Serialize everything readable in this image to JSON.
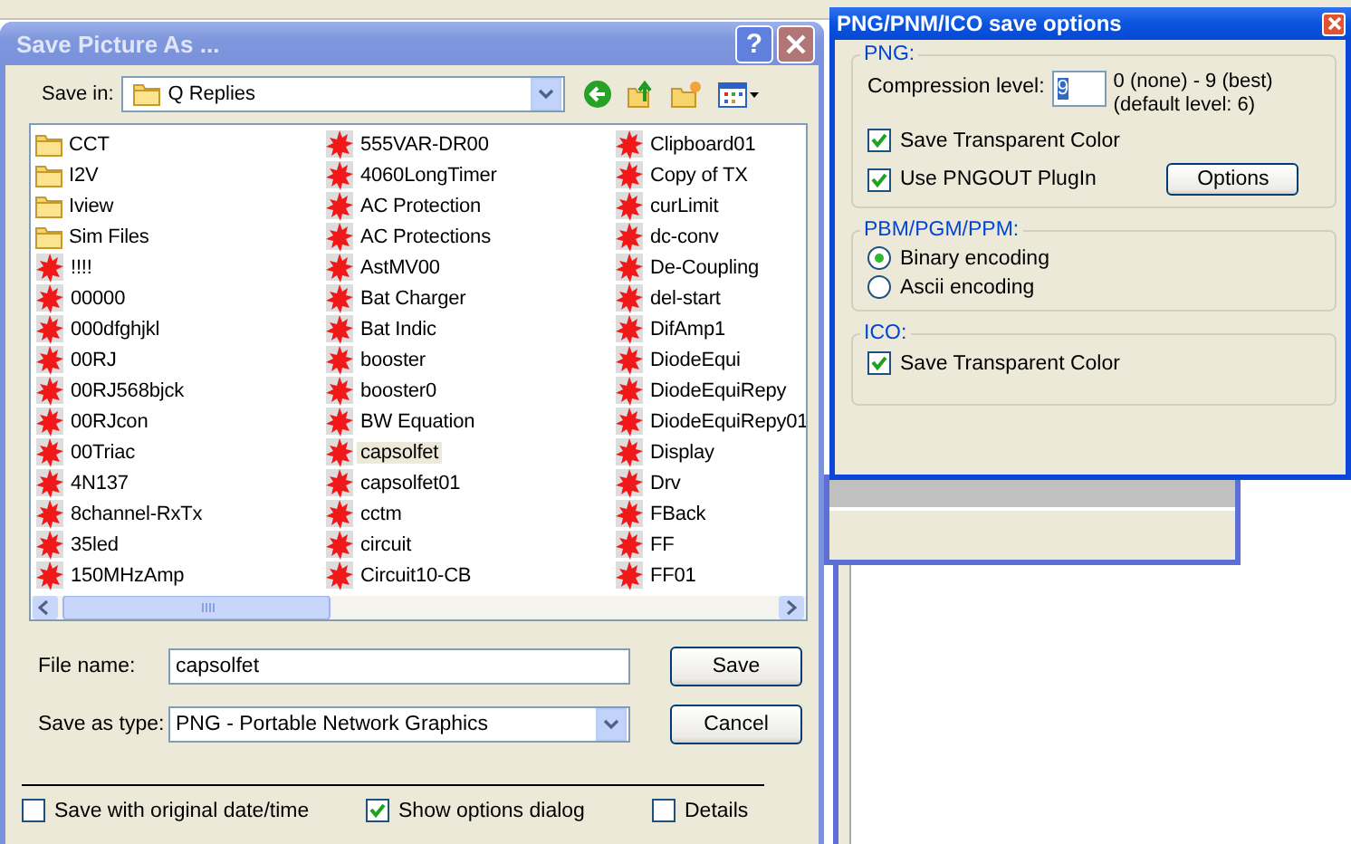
{
  "save_dialog": {
    "title": "Save Picture As ...",
    "help_button": "?",
    "save_in": {
      "label": "Save in:",
      "value": "Q Replies"
    },
    "files": [
      {
        "name": "CCT",
        "kind": "folder",
        "selected": false
      },
      {
        "name": "I2V",
        "kind": "folder",
        "selected": false
      },
      {
        "name": "Iview",
        "kind": "folder",
        "selected": false
      },
      {
        "name": "Sim Files",
        "kind": "folder",
        "selected": false
      },
      {
        "name": "!!!!",
        "kind": "file",
        "selected": false
      },
      {
        "name": "00000",
        "kind": "file",
        "selected": false
      },
      {
        "name": "000dfghjkl",
        "kind": "file",
        "selected": false
      },
      {
        "name": "00RJ",
        "kind": "file",
        "selected": false
      },
      {
        "name": "00RJ568bjck",
        "kind": "file",
        "selected": false
      },
      {
        "name": "00RJcon",
        "kind": "file",
        "selected": false
      },
      {
        "name": "00Triac",
        "kind": "file",
        "selected": false
      },
      {
        "name": "4N137",
        "kind": "file",
        "selected": false
      },
      {
        "name": "8channel-RxTx",
        "kind": "file",
        "selected": false
      },
      {
        "name": "35led",
        "kind": "file",
        "selected": false
      },
      {
        "name": "150MHzAmp",
        "kind": "file",
        "selected": false
      },
      {
        "name": "555VAR-DR00",
        "kind": "file",
        "selected": false
      },
      {
        "name": "4060LongTimer",
        "kind": "file",
        "selected": false
      },
      {
        "name": "AC Protection",
        "kind": "file",
        "selected": false
      },
      {
        "name": "AC Protections",
        "kind": "file",
        "selected": false
      },
      {
        "name": "AstMV00",
        "kind": "file",
        "selected": false
      },
      {
        "name": "Bat Charger",
        "kind": "file",
        "selected": false
      },
      {
        "name": "Bat Indic",
        "kind": "file",
        "selected": false
      },
      {
        "name": "booster",
        "kind": "file",
        "selected": false
      },
      {
        "name": "booster0",
        "kind": "file",
        "selected": false
      },
      {
        "name": "BW Equation",
        "kind": "file",
        "selected": false
      },
      {
        "name": "capsolfet",
        "kind": "file",
        "selected": true
      },
      {
        "name": "capsolfet01",
        "kind": "file",
        "selected": false
      },
      {
        "name": "cctm",
        "kind": "file",
        "selected": false
      },
      {
        "name": "circuit",
        "kind": "file",
        "selected": false
      },
      {
        "name": "Circuit10-CB",
        "kind": "file",
        "selected": false
      },
      {
        "name": "Clipboard01",
        "kind": "file",
        "selected": false
      },
      {
        "name": "Copy of TX",
        "kind": "file",
        "selected": false
      },
      {
        "name": "curLimit",
        "kind": "file",
        "selected": false
      },
      {
        "name": "dc-conv",
        "kind": "file",
        "selected": false
      },
      {
        "name": "De-Coupling",
        "kind": "file",
        "selected": false
      },
      {
        "name": "del-start",
        "kind": "file",
        "selected": false
      },
      {
        "name": "DifAmp1",
        "kind": "file",
        "selected": false
      },
      {
        "name": "DiodeEqui",
        "kind": "file",
        "selected": false
      },
      {
        "name": "DiodeEquiRepy",
        "kind": "file",
        "selected": false
      },
      {
        "name": "DiodeEquiRepy01",
        "kind": "file",
        "selected": false
      },
      {
        "name": "Display",
        "kind": "file",
        "selected": false
      },
      {
        "name": "Drv",
        "kind": "file",
        "selected": false
      },
      {
        "name": "FBack",
        "kind": "file",
        "selected": false
      },
      {
        "name": "FF",
        "kind": "file",
        "selected": false
      },
      {
        "name": "FF01",
        "kind": "file",
        "selected": false
      }
    ],
    "file_name": {
      "label": "File name:",
      "value": "capsolfet"
    },
    "save_as_type": {
      "label": "Save as type:",
      "value": "PNG - Portable Network Graphics"
    },
    "buttons": [
      "Save",
      "Cancel"
    ],
    "options": [
      {
        "label": "Save with original date/time",
        "checked": false
      },
      {
        "label": "Show options dialog",
        "checked": true
      },
      {
        "label": "Details",
        "checked": false
      }
    ]
  },
  "options_dialog": {
    "title": "PNG/PNM/ICO save options",
    "groups": [
      {
        "title": "PNG:",
        "items": [
          {
            "kind": "number",
            "label": "Compression level:",
            "value": "9",
            "hint": [
              "0 (none) - 9 (best)",
              "(default level: 6)"
            ]
          },
          {
            "kind": "checkbox",
            "label": "Save Transparent Color",
            "checked": true
          },
          {
            "kind": "checkbox",
            "label": "Use PNGOUT PlugIn",
            "checked": true,
            "button": "Options"
          }
        ]
      },
      {
        "title": "PBM/PGM/PPM:",
        "items": [
          {
            "kind": "radio",
            "label": "Binary encoding",
            "selected": true
          },
          {
            "kind": "radio",
            "label": "Ascii encoding",
            "selected": false
          }
        ]
      },
      {
        "title": "ICO:",
        "items": [
          {
            "kind": "checkbox",
            "label": "Save Transparent Color",
            "checked": true
          }
        ]
      }
    ]
  }
}
